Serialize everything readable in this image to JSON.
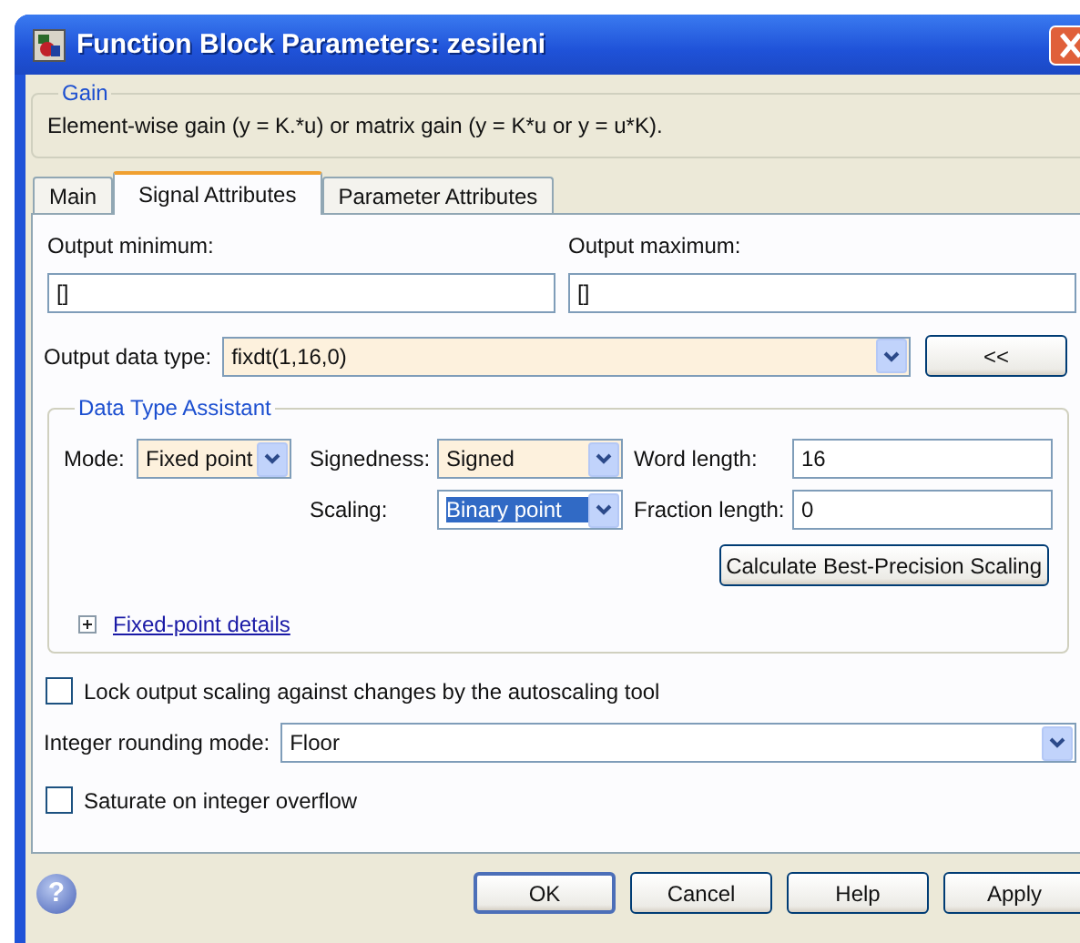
{
  "window": {
    "title": "Function Block Parameters: zesileni"
  },
  "gain": {
    "legend": "Gain",
    "description": "Element-wise gain (y = K.*u) or matrix gain (y = K*u or y = u*K)."
  },
  "tabs": [
    {
      "label": "Main",
      "selected": false
    },
    {
      "label": "Signal Attributes",
      "selected": true
    },
    {
      "label": "Parameter Attributes",
      "selected": false
    }
  ],
  "output_minimum": {
    "label": "Output minimum:",
    "value": "[]"
  },
  "output_maximum": {
    "label": "Output maximum:",
    "value": "[]"
  },
  "output_data_type": {
    "label": "Output data type:",
    "value": "fixdt(1,16,0)",
    "toggle": "<<"
  },
  "data_type_assistant": {
    "legend": "Data Type Assistant",
    "mode": {
      "label": "Mode:",
      "value": "Fixed point"
    },
    "signedness": {
      "label": "Signedness:",
      "value": "Signed"
    },
    "word_length": {
      "label": "Word length:",
      "value": "16"
    },
    "scaling": {
      "label": "Scaling:",
      "value": "Binary point",
      "selected": true
    },
    "fraction_length": {
      "label": "Fraction length:",
      "value": "0"
    },
    "calculate_button": "Calculate Best-Precision Scaling",
    "details": {
      "label": "Fixed-point details",
      "expanded": false
    }
  },
  "lock_scaling": {
    "label": "Lock output scaling against changes by the autoscaling tool",
    "checked": false
  },
  "rounding": {
    "label": "Integer rounding mode:",
    "value": "Floor"
  },
  "saturate": {
    "label": "Saturate on integer overflow",
    "checked": false
  },
  "help_glyph": "?",
  "buttons": [
    {
      "label": "OK",
      "default": true
    },
    {
      "label": "Cancel",
      "default": false
    },
    {
      "label": "Help",
      "default": false
    },
    {
      "label": "Apply",
      "default": false
    }
  ]
}
